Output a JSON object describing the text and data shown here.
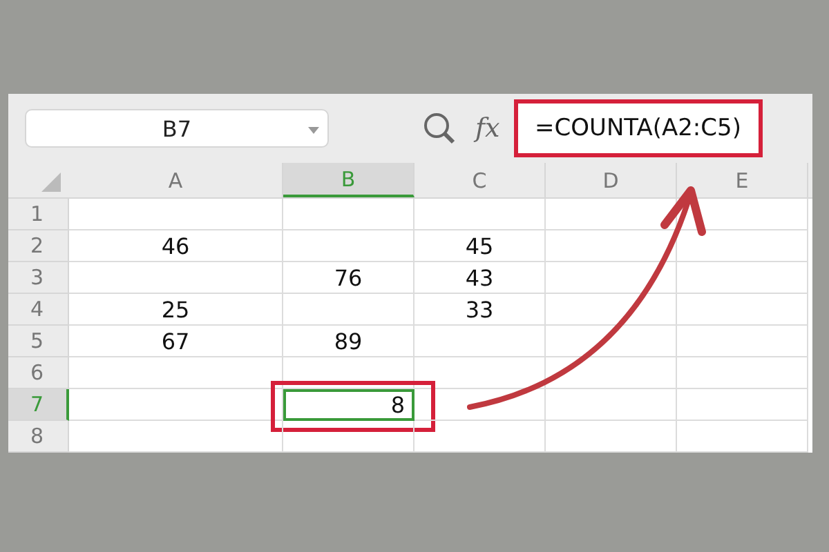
{
  "name_box": {
    "value": "B7"
  },
  "function_label": "fx",
  "formula": {
    "value": "=COUNTA(A2:C5)",
    "highlighted": true
  },
  "columns": [
    {
      "label": "A",
      "selected": false
    },
    {
      "label": "B",
      "selected": true
    },
    {
      "label": "C",
      "selected": false
    },
    {
      "label": "D",
      "selected": false
    },
    {
      "label": "E",
      "selected": false
    }
  ],
  "rows": [
    {
      "label": "1",
      "selected": false,
      "cells": [
        null,
        null,
        null,
        null,
        null
      ]
    },
    {
      "label": "2",
      "selected": false,
      "cells": [
        {
          "value": "46",
          "selected": false
        },
        null,
        {
          "value": "45",
          "selected": false
        },
        null,
        null
      ]
    },
    {
      "label": "3",
      "selected": false,
      "cells": [
        null,
        {
          "value": "76",
          "selected": false
        },
        {
          "value": "43",
          "selected": false
        },
        null,
        null
      ]
    },
    {
      "label": "4",
      "selected": false,
      "cells": [
        {
          "value": "25",
          "selected": false
        },
        null,
        {
          "value": "33",
          "selected": false
        },
        null,
        null
      ]
    },
    {
      "label": "5",
      "selected": false,
      "cells": [
        {
          "value": "67",
          "selected": false
        },
        {
          "value": "89",
          "selected": false
        },
        null,
        null,
        null
      ]
    },
    {
      "label": "6",
      "selected": false,
      "cells": [
        null,
        null,
        null,
        null,
        null
      ]
    },
    {
      "label": "7",
      "selected": true,
      "cells": [
        null,
        {
          "value": "8",
          "selected": true,
          "highlighted": true
        },
        null,
        null,
        null
      ]
    },
    {
      "label": "8",
      "selected": false,
      "cells": [
        null,
        null,
        null,
        null,
        null
      ]
    }
  ],
  "callout_arrow": true
}
